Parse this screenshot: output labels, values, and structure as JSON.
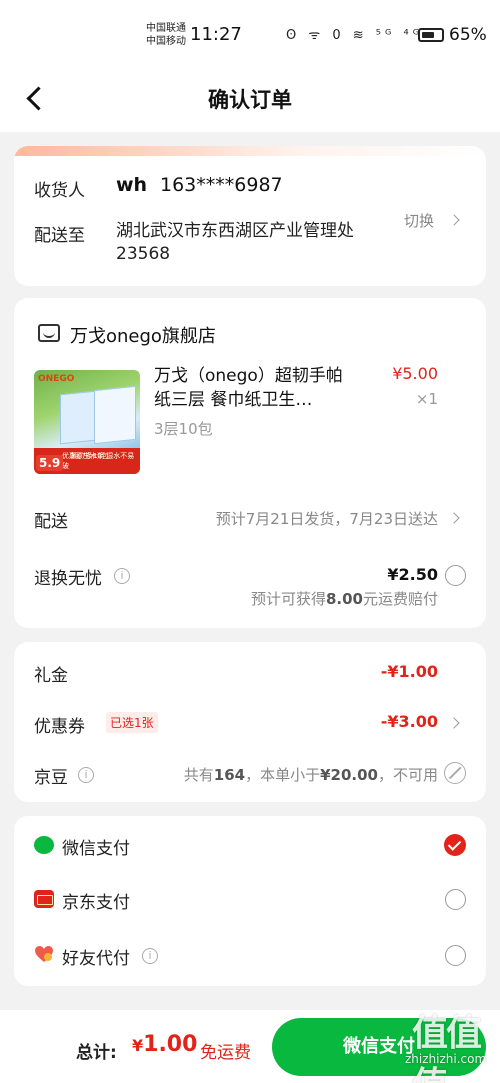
{
  "status_bar": {
    "carrier_1": "中国联通",
    "carrier_2": "中国移动",
    "time": "11:27",
    "icons": "ʘ ᯤ 0 ≋ ⁵ᴳ ⁴ᴳ",
    "battery_level": 0.65,
    "battery_text": "65%"
  },
  "header": {
    "title": "确认订单"
  },
  "address": {
    "receiver_label": "收货人",
    "receiver_name": "wh",
    "receiver_phone": "163****6987",
    "ship_to_label": "配送至",
    "address_text": "湖北武汉市东西湖区产业管理处23568",
    "switch_label": "切换"
  },
  "store": {
    "name": "万戈onego旗舰店"
  },
  "product": {
    "title": "万戈（onego）超韧手帕纸三层 餐巾纸卫生…",
    "spec": "3层10包",
    "price": "¥5.00",
    "quantity": "×1",
    "image": {
      "brand": "ONEGO",
      "price_tag": "5.9",
      "promo_line1": "3层7条10包",
      "promo_line2": "优惠原生木浆 湿水不易破"
    }
  },
  "delivery": {
    "label": "配送",
    "info": "预计7月21日发货，7月23日送达"
  },
  "refund": {
    "label": "退换无忧",
    "price": "¥2.50",
    "note_prefix": "预计可获得",
    "note_amount": "8.00",
    "note_suffix": "元运费赔付"
  },
  "discounts": {
    "gift_label": "礼金",
    "gift_value": "-¥1.00",
    "coupon_label": "优惠券",
    "coupon_badge": "已选1张",
    "coupon_value": "-¥3.00",
    "jd_label": "京豆",
    "jd_note_prefix": "共有",
    "jd_count": "164",
    "jd_note_mid": "，本单小于",
    "jd_threshold": "¥20.00",
    "jd_note_suffix": "，不可用"
  },
  "payment": {
    "methods": [
      {
        "label": "微信支付",
        "icon": "wechat-icon",
        "selected": true
      },
      {
        "label": "京东支付",
        "icon": "jdpay-icon",
        "selected": false
      },
      {
        "label": "好友代付",
        "icon": "friend-heart-icon",
        "selected": false
      }
    ]
  },
  "footer": {
    "total_label": "总计:",
    "currency": "¥",
    "total_amount": "1.00",
    "free_shipping": "免运费",
    "pay_button": "微信支付"
  },
  "watermark": {
    "main": "值值值",
    "sub": "zhizhizhi.com"
  },
  "colors": {
    "accent_red": "#e2231a",
    "wechat_green": "#09b83e"
  }
}
